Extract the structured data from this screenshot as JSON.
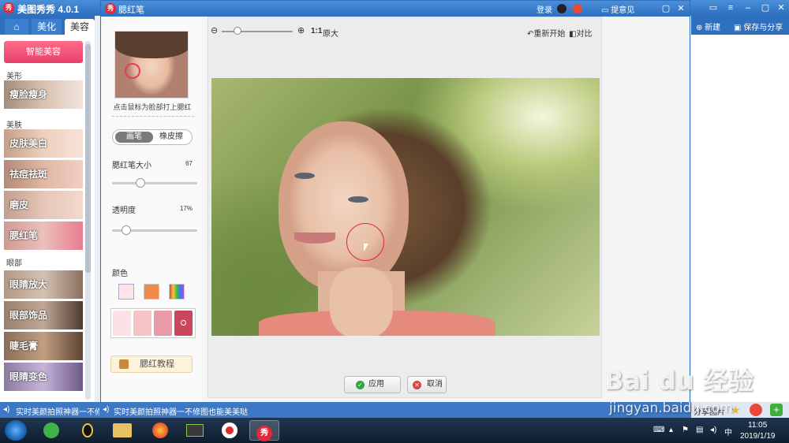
{
  "app": {
    "title": "美图秀秀 4.0.1",
    "logo_text": "秀"
  },
  "main_tabs": [
    {
      "label": "⌂",
      "icon": "home-icon"
    },
    {
      "label": "美化"
    },
    {
      "label": "美容",
      "active": true
    }
  ],
  "left_panel": {
    "smart_button": "智能美容",
    "sections": [
      {
        "label": "美形",
        "items": [
          "瘦脸瘦身"
        ]
      },
      {
        "label": "美肤",
        "items": [
          "皮肤美白",
          "祛痘祛斑",
          "磨皮",
          "腮红笔"
        ]
      },
      {
        "label": "眼部",
        "items": [
          "眼睛放大",
          "眼部饰品",
          "睫毛膏",
          "眼睛变色"
        ]
      }
    ]
  },
  "dialog": {
    "title": "腮红笔",
    "login": "登录",
    "feedback": "提意见",
    "thumb_caption": "点击鼠标为脸部打上腮红",
    "modes": [
      "画笔",
      "橡皮擦"
    ],
    "size_label": "腮红笔大小",
    "size_value": "67",
    "size_fraction": 0.33,
    "opacity_label": "透明度",
    "opacity_value": "17%",
    "opacity_fraction": 0.17,
    "color_label": "颜色",
    "swatches": [
      "#fbe1e6",
      "#f5c4c6",
      "#e89aa6",
      "#c8475e"
    ],
    "tutorial_label": "腮红教程",
    "toolbar": {
      "ratio": "1:1",
      "original": "原大",
      "restart": "重新开始",
      "compare": "对比"
    },
    "apply_label": "应用",
    "cancel_label": "取消"
  },
  "right_panel": {
    "new_label": "新建",
    "save_label": "保存与分享",
    "share_label": "分享图片"
  },
  "status_bar": {
    "left_text": "实时美颜拍照神器一不修图",
    "right_text": "实时美颜拍照神器一不修图也能美美哒"
  },
  "taskbar": {
    "time": "11:05",
    "date": "2019/1/19"
  },
  "watermark": {
    "logo": "Bai du 经验",
    "url": "jingyan.baidu.com"
  }
}
